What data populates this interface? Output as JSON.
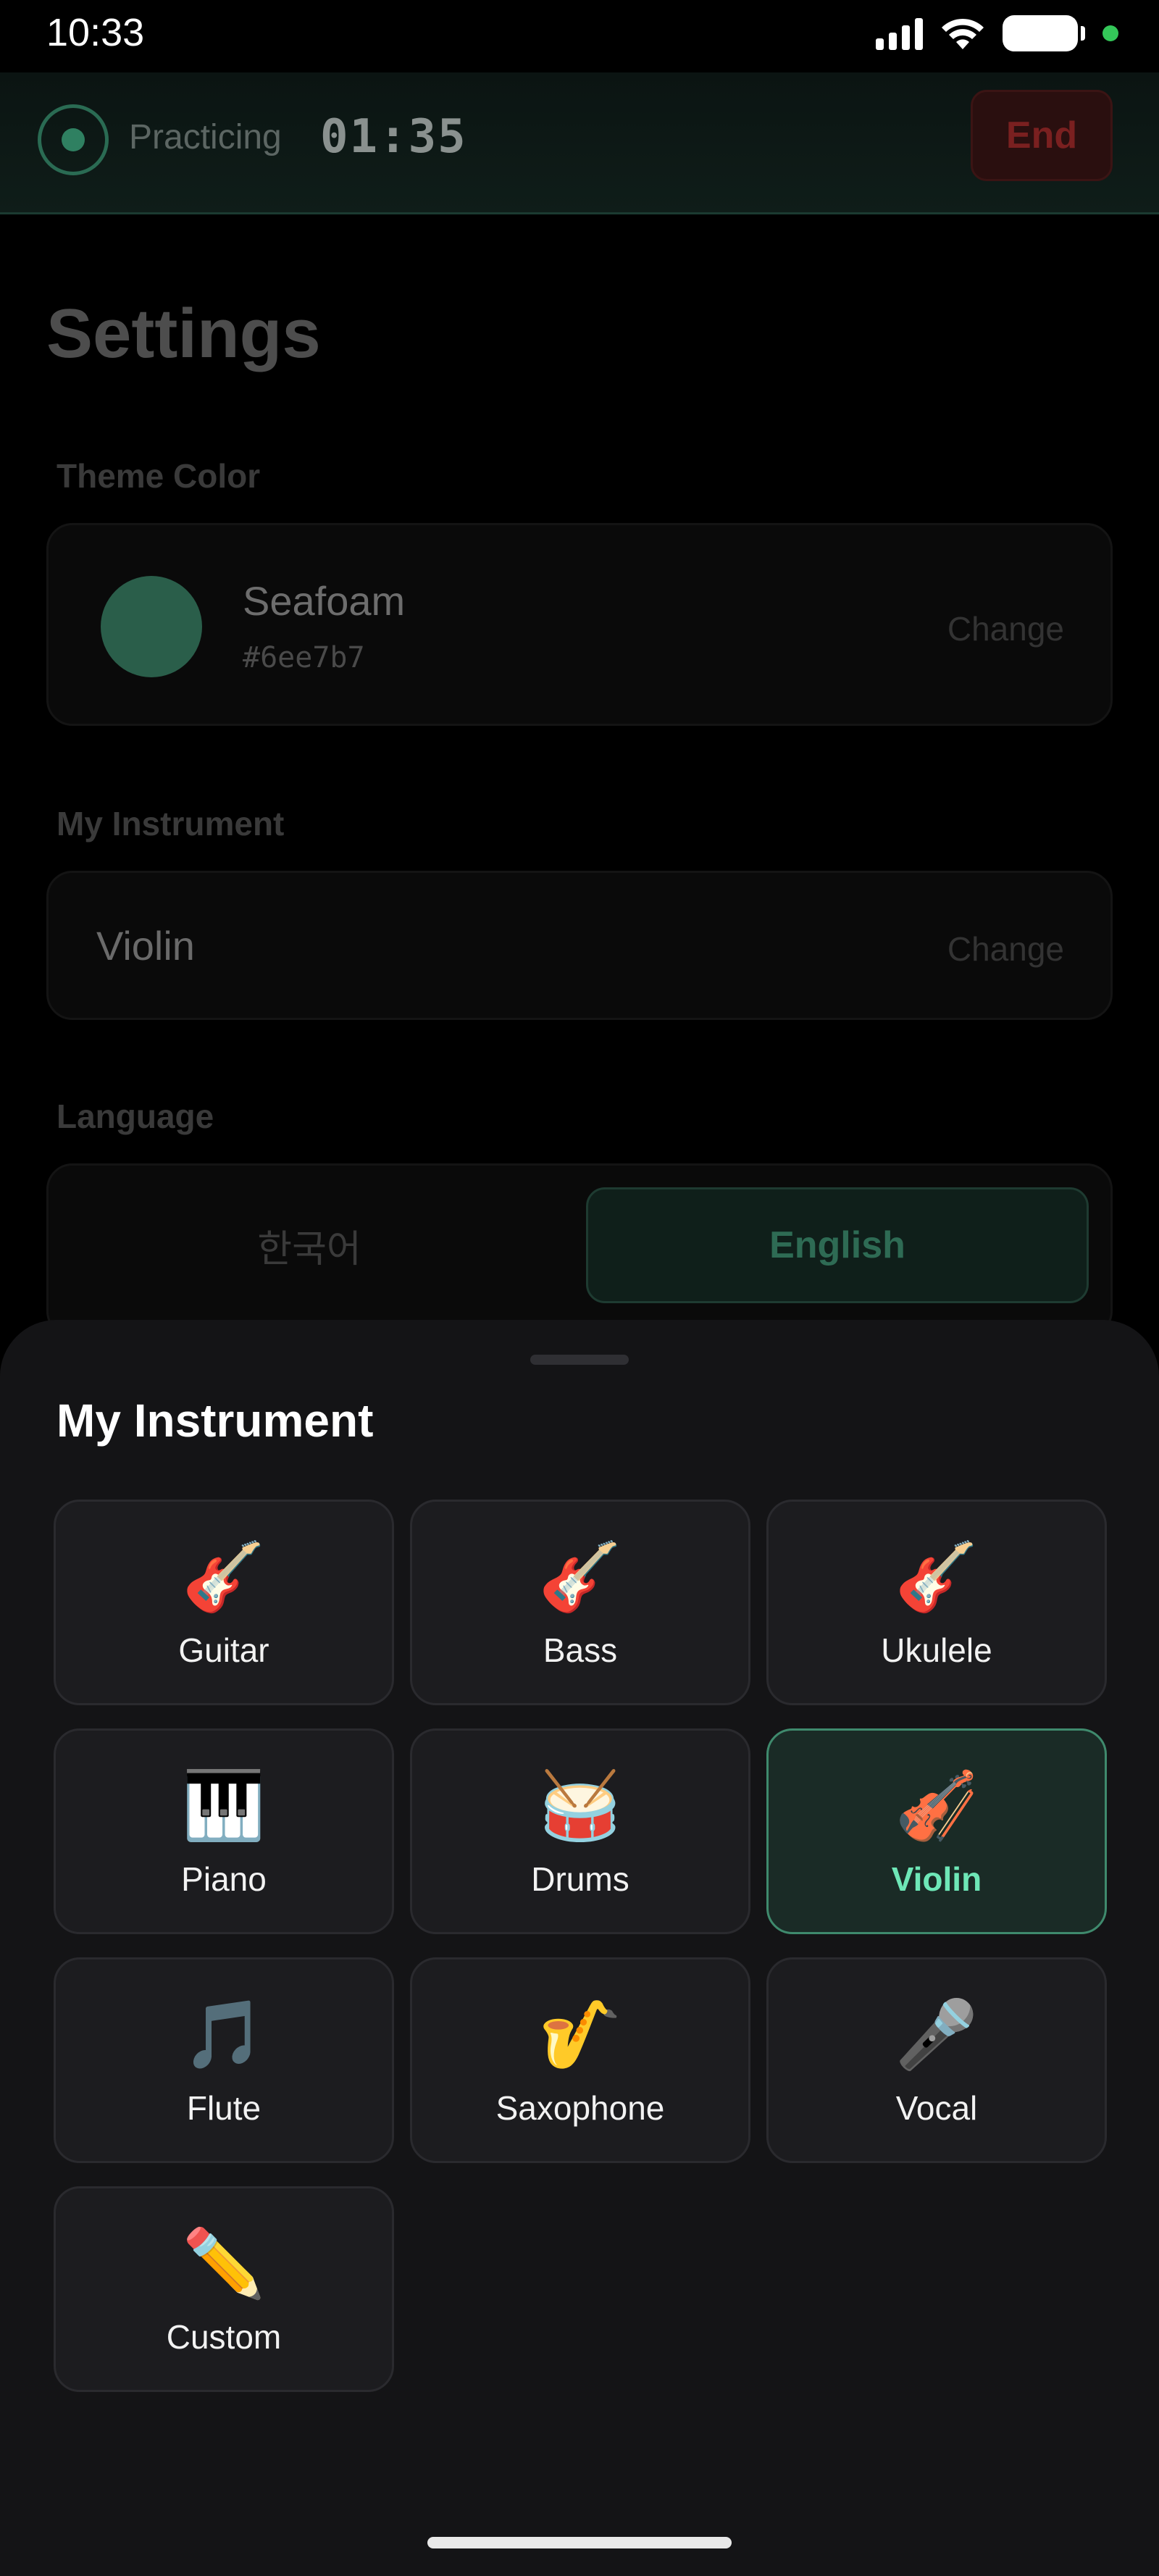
{
  "status_bar": {
    "time": "10:33"
  },
  "practice": {
    "status": "Practicing",
    "timer": "01:35",
    "end_label": "End"
  },
  "settings": {
    "title": "Settings",
    "theme": {
      "section_label": "Theme Color",
      "name": "Seafoam",
      "hex": "#6ee7b7",
      "change_label": "Change"
    },
    "instrument": {
      "section_label": "My Instrument",
      "value": "Violin",
      "change_label": "Change"
    },
    "language": {
      "section_label": "Language",
      "options": [
        "한국어",
        "English"
      ],
      "selected": "English"
    }
  },
  "sheet": {
    "title": "My Instrument",
    "selected": "Violin",
    "instruments": [
      {
        "label": "Guitar",
        "icon": "🎸",
        "icon_name": "guitar-icon"
      },
      {
        "label": "Bass",
        "icon": "🎸",
        "icon_name": "bass-icon"
      },
      {
        "label": "Ukulele",
        "icon": "🎸",
        "icon_name": "ukulele-icon"
      },
      {
        "label": "Piano",
        "icon": "🎹",
        "icon_name": "piano-icon"
      },
      {
        "label": "Drums",
        "icon": "🥁",
        "icon_name": "drum-icon"
      },
      {
        "label": "Violin",
        "icon": "🎻",
        "icon_name": "violin-icon"
      },
      {
        "label": "Flute",
        "icon": "🎵",
        "icon_name": "music-note-icon"
      },
      {
        "label": "Saxophone",
        "icon": "🎷",
        "icon_name": "saxophone-icon"
      },
      {
        "label": "Vocal",
        "icon": "🎤",
        "icon_name": "microphone-icon"
      },
      {
        "label": "Custom",
        "icon": "✏️",
        "icon_name": "pencil-icon"
      }
    ]
  },
  "colors": {
    "accent": "#6ee7b7",
    "end_button": "#7a2020",
    "sheet_background": "#141416"
  }
}
